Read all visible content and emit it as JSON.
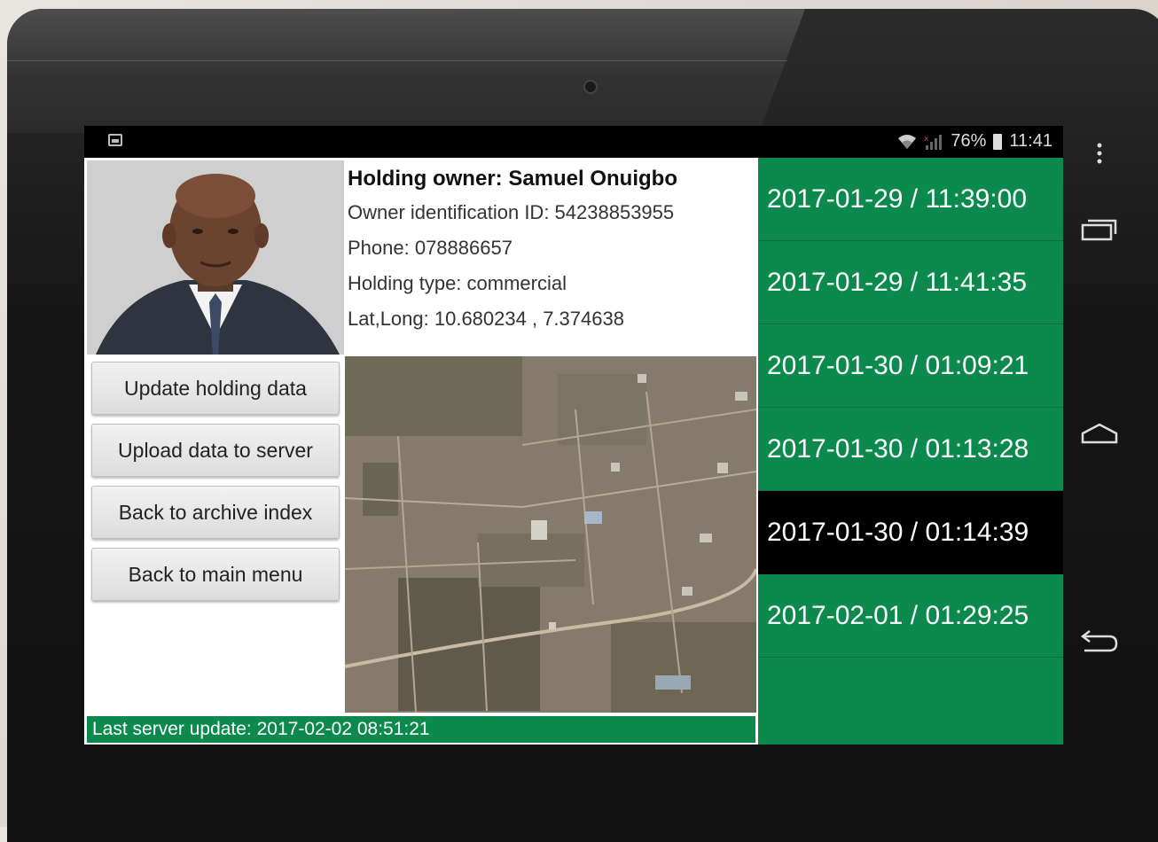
{
  "status_bar": {
    "battery_percent": "76%",
    "time": "11:41"
  },
  "owner": {
    "title": "Holding owner: Samuel Onuigbo",
    "id_line": "Owner identification ID: 54238853955",
    "phone_line": "Phone: 078886657",
    "type_line": "Holding type: commercial",
    "latlong_line": "Lat,Long: 10.680234 ,  7.374638"
  },
  "buttons": {
    "update": "Update holding data",
    "upload": "Upload data to server",
    "archive": "Back to archive index",
    "main_menu": "Back to main menu"
  },
  "footer": {
    "last_update": "Last server update: 2017-02-02 08:51:21"
  },
  "dates": [
    {
      "label": "2017-01-29 / 11:39:00",
      "selected": false
    },
    {
      "label": "2017-01-29 / 11:41:35",
      "selected": false
    },
    {
      "label": "2017-01-30 / 01:09:21",
      "selected": false
    },
    {
      "label": "2017-01-30 / 01:13:28",
      "selected": false
    },
    {
      "label": "2017-01-30 / 01:14:39",
      "selected": true
    },
    {
      "label": "2017-02-01 / 01:29:25",
      "selected": false
    }
  ],
  "colors": {
    "accent_green": "#0c8a4e",
    "selected_bg": "#000000"
  },
  "icons": {
    "status_left": "image-notification-icon",
    "wifi": "wifi-icon",
    "signal": "signal-icon",
    "battery": "battery-icon",
    "overflow": "overflow-menu-icon",
    "recents": "recent-apps-icon",
    "home": "home-icon",
    "back": "back-icon"
  }
}
